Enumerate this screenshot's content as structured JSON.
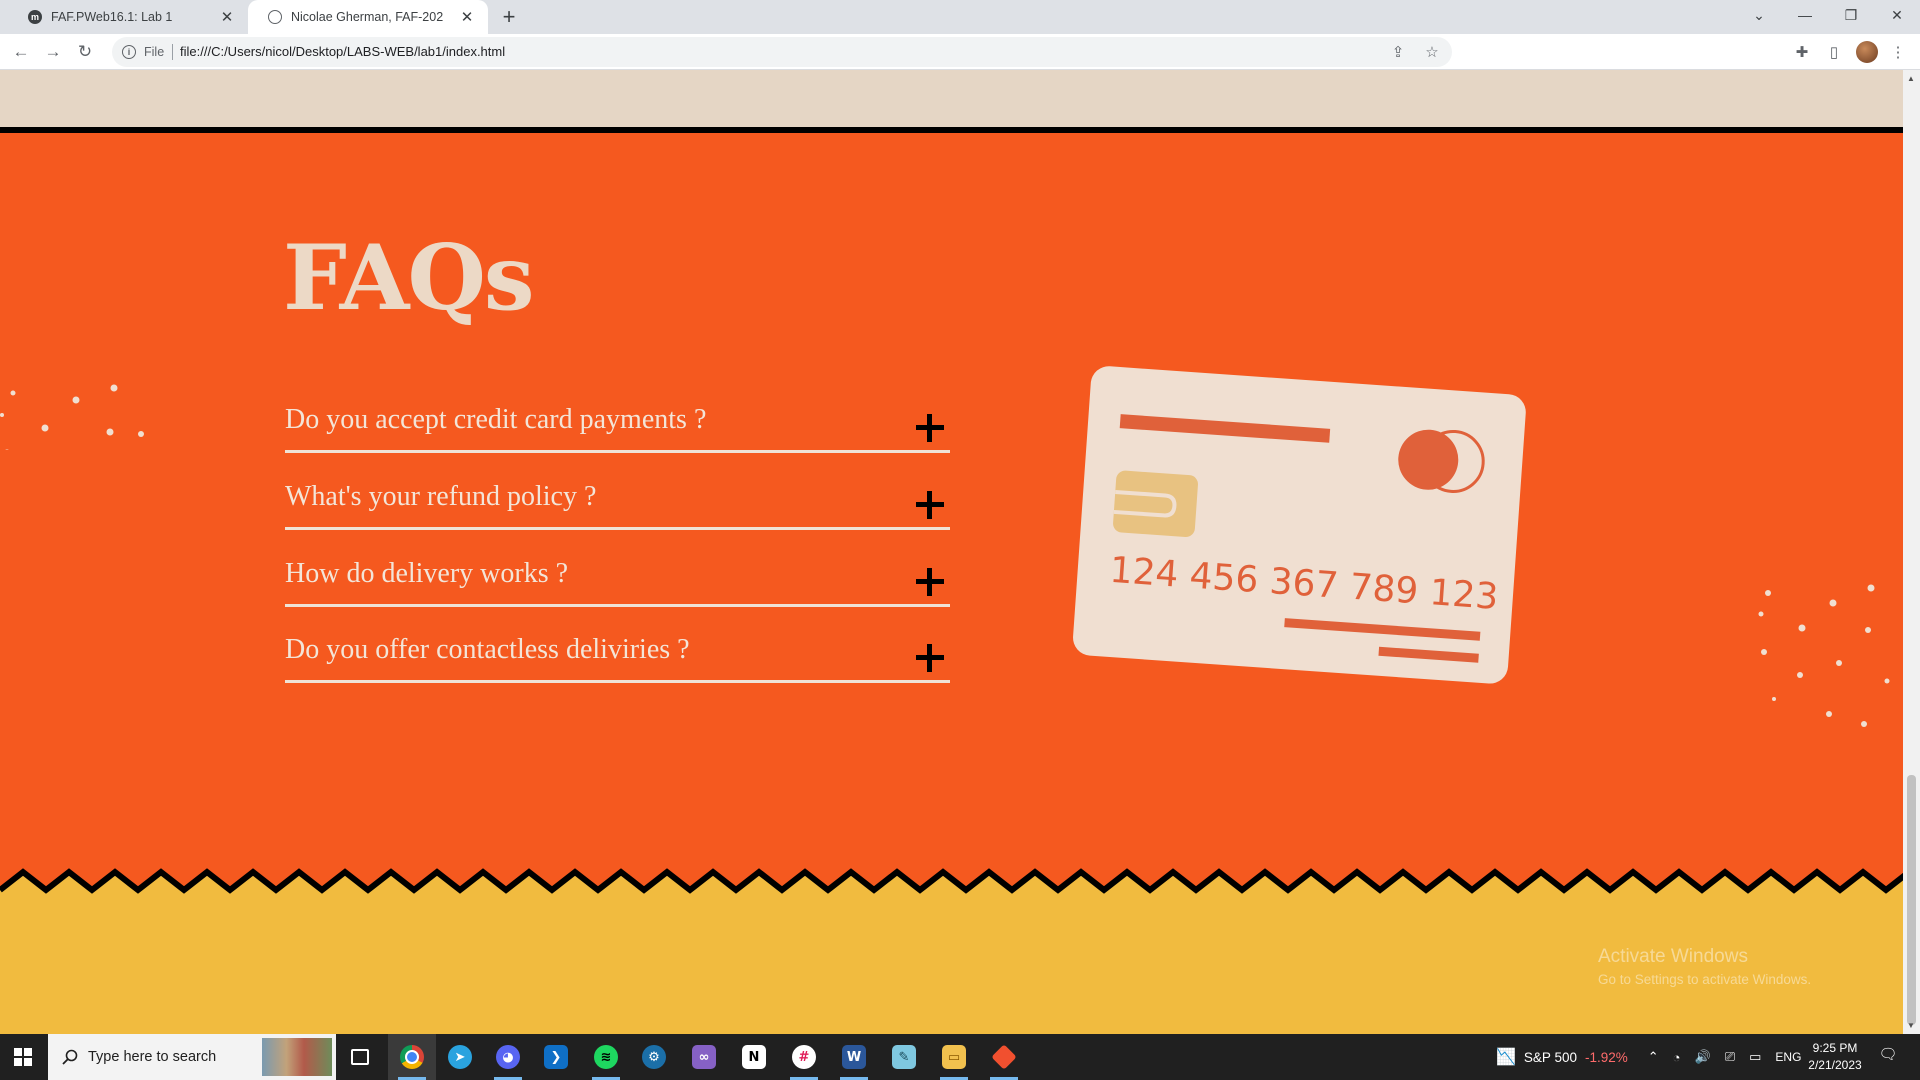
{
  "browser": {
    "tabs": [
      {
        "title": "FAF.PWeb16.1: Lab 1",
        "active": false
      },
      {
        "title": "Nicolae Gherman, FAF-202",
        "active": true
      }
    ],
    "site_info_label": "File",
    "url": "file:///C:/Users/nicol/Desktop/LABS-WEB/lab1/index.html"
  },
  "page": {
    "faq_heading": "FAQs",
    "faqs": [
      {
        "question": "Do you accept credit card payments ?"
      },
      {
        "question": "What's your refund policy ?"
      },
      {
        "question": "How do delivery works ?"
      },
      {
        "question": "Do you offer contactless deliviries ?"
      }
    ],
    "card_number": "124 456 367 789 123",
    "colors": {
      "primary_bg": "#f5591f",
      "top_band": "#e5d6c5",
      "footer_bg": "#f1bb3f",
      "card": "#f0dfd1",
      "card_chip": "#e8c281",
      "card_accent": "#e0613a"
    },
    "watermark": {
      "line1": "Activate Windows",
      "line2": "Go to Settings to activate Windows."
    }
  },
  "taskbar": {
    "search_placeholder": "Type here to search",
    "apps": [
      "task-view",
      "chrome",
      "telegram",
      "discord",
      "vscode",
      "spotify",
      "steam",
      "visual-studio",
      "notion",
      "slack",
      "word",
      "notepad",
      "file-explorer",
      "git"
    ],
    "stock_name": "S&P 500",
    "stock_change": "-1.92%",
    "language": "ENG",
    "time": "9:25 PM",
    "date": "2/21/2023"
  }
}
